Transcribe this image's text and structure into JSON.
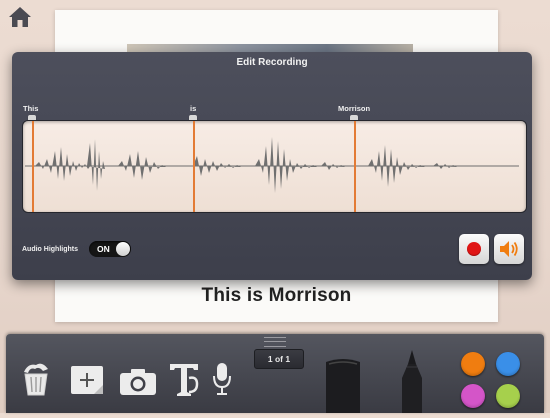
{
  "header": {
    "home_icon": "home-icon"
  },
  "page": {
    "title": "This is Morrison"
  },
  "edit_recording": {
    "title": "Edit Recording",
    "words": [
      {
        "label": "This"
      },
      {
        "label": "is"
      },
      {
        "label": "Morrison"
      }
    ],
    "audio_highlights_label": "Audio Highlights",
    "audio_highlights_state": "ON",
    "record_icon": "record-icon",
    "speaker_icon": "speaker-icon"
  },
  "toolbar": {
    "page_counter": "1 of 1",
    "tools": [
      "trash-icon",
      "add-note-icon",
      "camera-icon",
      "text-tool-icon",
      "microphone-icon",
      "marker-icon",
      "pen-icon"
    ],
    "colors": [
      "#f07d10",
      "#3a8fe8",
      "#d455c8",
      "#a6d04c"
    ]
  },
  "colors": {
    "marker": "#e37b35",
    "record": "#e01515",
    "speaker": "#f07d10"
  }
}
